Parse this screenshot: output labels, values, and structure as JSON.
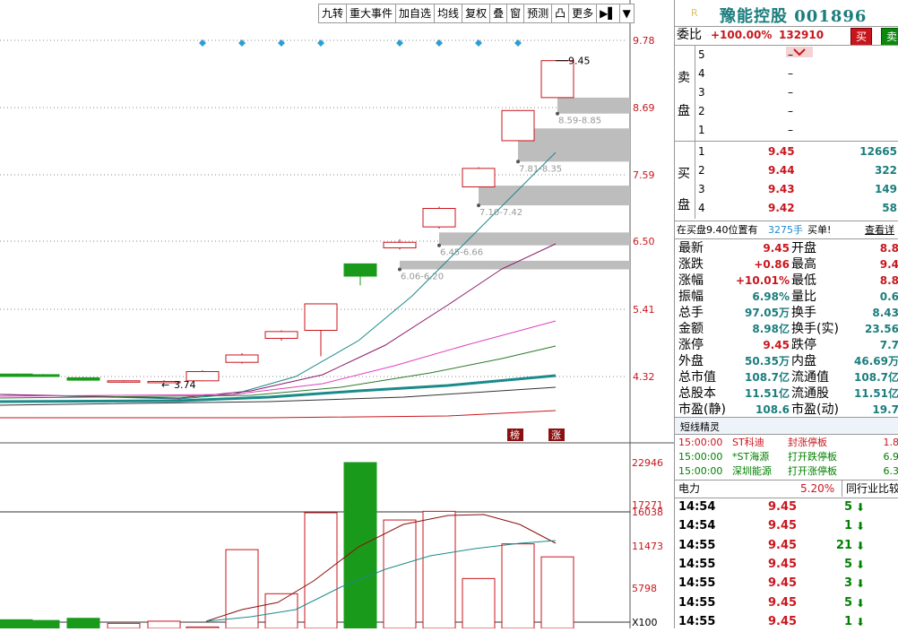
{
  "toolbar": [
    "九转",
    "重大事件",
    "加自选",
    "均线",
    "复权",
    "叠",
    "窗",
    "预测",
    "凸",
    "更多",
    "▶▌",
    "▼"
  ],
  "stock": {
    "name_code": "豫能控股 001896",
    "badge": "R"
  },
  "weibi": {
    "label": "委比",
    "value": "+100.00%",
    "diff": "132910",
    "buy_btn": "买",
    "sell_btn": "卖"
  },
  "sell_side_label": [
    "卖",
    "盘"
  ],
  "buy_side_label": [
    "买",
    "盘"
  ],
  "sell_levels": [
    {
      "level": "5",
      "price": "",
      "vol": "–"
    },
    {
      "level": "4",
      "price": "",
      "vol": "–"
    },
    {
      "level": "3",
      "price": "",
      "vol": "–"
    },
    {
      "level": "2",
      "price": "",
      "vol": "–"
    },
    {
      "level": "1",
      "price": "",
      "vol": "–"
    }
  ],
  "buy_levels": [
    {
      "level": "1",
      "price": "9.45",
      "vol": "12665"
    },
    {
      "level": "2",
      "price": "9.44",
      "vol": "322"
    },
    {
      "level": "3",
      "price": "9.43",
      "vol": "149"
    },
    {
      "level": "4",
      "price": "9.42",
      "vol": "58"
    }
  ],
  "notice": {
    "text1": "在买盘9.40位置有",
    "qty": "3275手",
    "text2": "买单!",
    "link": "查看详"
  },
  "quote": [
    [
      "最新",
      "9.45",
      "开盘",
      "8.8"
    ],
    [
      "涨跌",
      "+0.86",
      "最高",
      "9.4"
    ],
    [
      "涨幅",
      "+10.01%",
      "最低",
      "8.8"
    ],
    [
      "振幅",
      "6.98%",
      "量比",
      "0.6"
    ],
    [
      "总手",
      "97.05万",
      "换手",
      "8.43"
    ],
    [
      "金额",
      "8.98亿",
      "换手(实)",
      "23.56"
    ],
    [
      "涨停",
      "9.45",
      "跌停",
      "7.7"
    ],
    [
      "外盘",
      "50.35万",
      "内盘",
      "46.69万"
    ],
    [
      "总市值",
      "108.7亿",
      "流通值",
      "108.7亿"
    ],
    [
      "总股本",
      "11.51亿",
      "流通股",
      "11.51亿"
    ],
    [
      "市盈(静)",
      "108.6",
      "市盈(动)",
      "19.7"
    ]
  ],
  "short_line": {
    "title": "短线精灵",
    "items": [
      {
        "time": "15:00:00",
        "name": "ST科迪",
        "event": "封涨停板",
        "val": "1.8"
      },
      {
        "time": "15:00:00",
        "name": "*ST海源",
        "event": "打开跌停板",
        "val": "6.9"
      },
      {
        "time": "15:00:00",
        "name": "深圳能源",
        "event": "打开涨停板",
        "val": "6.3"
      }
    ]
  },
  "industry": {
    "name": "电力",
    "pct": "5.20%",
    "compare": "同行业比较"
  },
  "ticks": [
    {
      "time": "14:54",
      "price": "9.45",
      "vol": "5"
    },
    {
      "time": "14:54",
      "price": "9.45",
      "vol": "1"
    },
    {
      "time": "14:55",
      "price": "9.45",
      "vol": "21"
    },
    {
      "time": "14:55",
      "price": "9.45",
      "vol": "5"
    },
    {
      "time": "14:55",
      "price": "9.45",
      "vol": "3"
    },
    {
      "time": "14:55",
      "price": "9.45",
      "vol": "5"
    },
    {
      "time": "14:55",
      "price": "9.45",
      "vol": "1"
    }
  ],
  "price_axis": [
    "9.78",
    "8.69",
    "7.59",
    "6.50",
    "5.41",
    "4.32"
  ],
  "vol_axis": [
    "22946",
    "17271",
    "16038",
    "11473",
    "5798",
    "X100"
  ],
  "price_annotations": {
    "high": "9.45",
    "low": "3.74"
  },
  "gap_labels": [
    "8.59-8.85",
    "7.81-8.35",
    "7.10-7.42",
    "6.45-6.66",
    "6.06-6.20"
  ],
  "markers": [
    "榜",
    "涨"
  ],
  "colors": {
    "up": "#c8161d",
    "down": "#1a9a1a",
    "ma_teal": "#1b8a8a",
    "ma_purple": "#8b1a6b",
    "ma_pink": "#e040c0",
    "ma_green": "#2a7a2a",
    "gap": "#bdbdbd",
    "diamond": "#2a9fd6"
  }
}
